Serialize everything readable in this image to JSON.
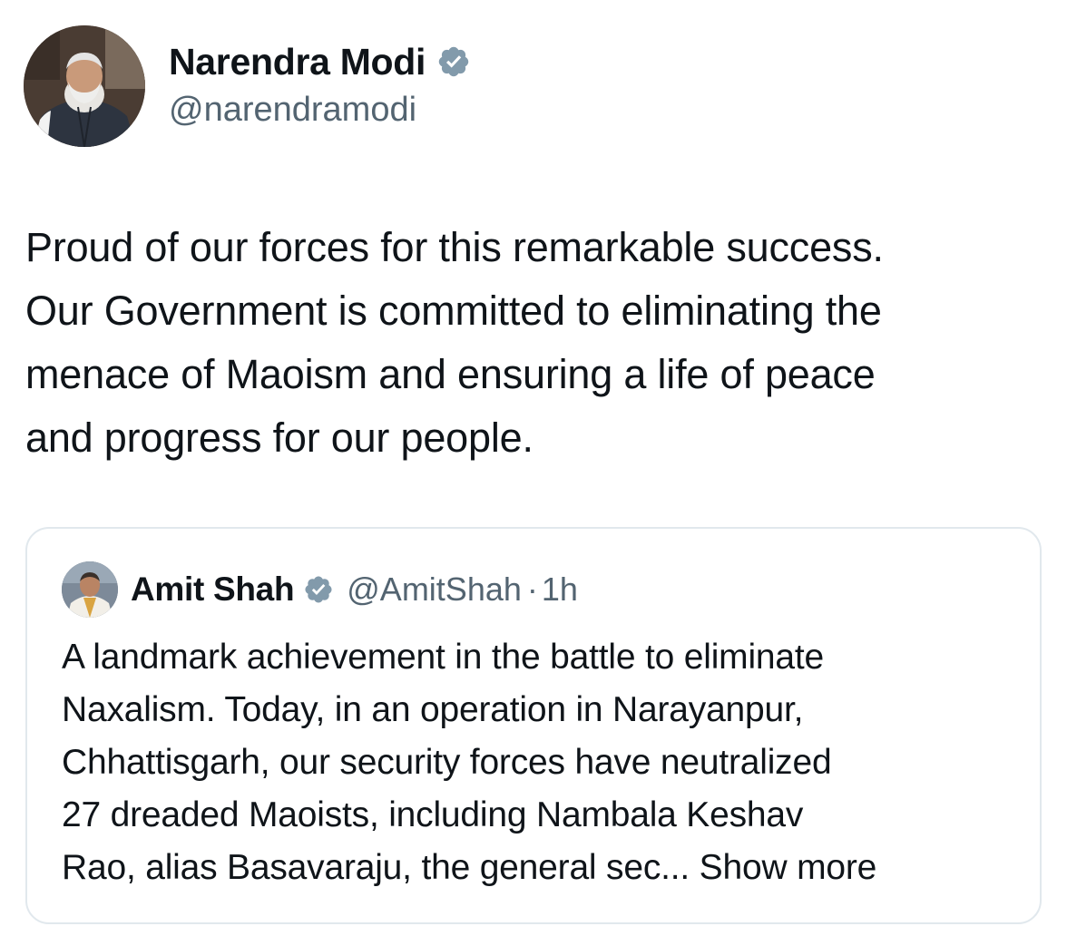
{
  "tweet": {
    "author": {
      "name": "Narendra Modi",
      "handle": "@narendramodi",
      "verified": true,
      "avatar": "avatar-photo"
    },
    "text": "Proud of our forces for this remarkable success.\nOur Government is committed to eliminating the\nmenace of Maoism and ensuring a life of peace\nand progress for our people."
  },
  "quoted_tweet": {
    "author": {
      "name": "Amit Shah",
      "handle": "@AmitShah",
      "verified": true,
      "avatar": "avatar-photo"
    },
    "separator": "·",
    "time": "1h",
    "text": "A landmark achievement in the battle to eliminate\nNaxalism. Today, in an operation in Narayanpur,\nChhattisgarh, our security forces have neutralized\n27 dreaded Maoists, including Nambala Keshav\nRao, alias Basavaraju, the general sec...",
    "show_more_label": "Show more"
  },
  "colors": {
    "text_primary": "#0f1419",
    "text_secondary": "#536471",
    "verified_badge": "#829aab",
    "card_border": "#e1e8ed"
  }
}
